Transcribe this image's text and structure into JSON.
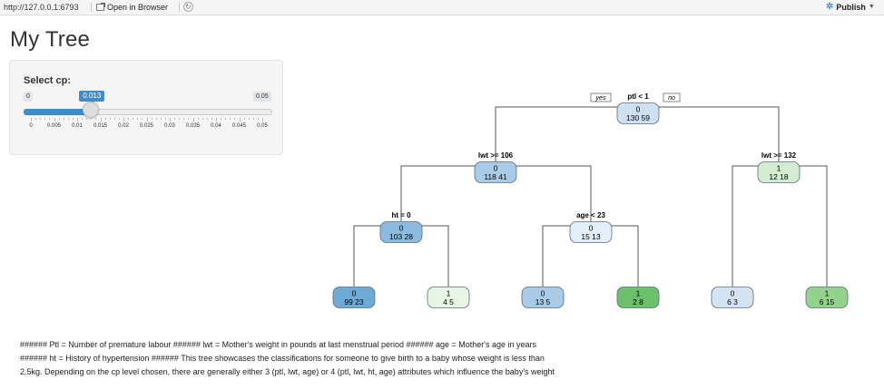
{
  "toolbar": {
    "url": "http://127.0.0.1:6793",
    "open_in_browser": "Open in Browser",
    "publish": "Publish"
  },
  "page": {
    "title": "My Tree"
  },
  "slider": {
    "label": "Select cp:",
    "min_label": "0",
    "max_label": "0.05",
    "value_label": "0.013",
    "value": 0.013,
    "min": 0,
    "max": 0.05,
    "ticks": [
      "0",
      "0.005",
      "0.01",
      "0.015",
      "0.02",
      "0.025",
      "0.03",
      "0.035",
      "0.04",
      "0.045",
      "0.05"
    ],
    "accent_color": "#428bca"
  },
  "tree": {
    "yes_label": "yes",
    "no_label": "no",
    "nodes": [
      {
        "id": "root",
        "cls": "0",
        "counts": "130  59",
        "split": "ptl < 1",
        "fill": "#cfe0f2"
      },
      {
        "id": "l",
        "cls": "0",
        "counts": "118  41",
        "split": "lwt >= 106",
        "fill": "#a8cbe8"
      },
      {
        "id": "r",
        "cls": "1",
        "counts": "12  18",
        "split": "lwt >= 132",
        "fill": "#d3ecd0"
      },
      {
        "id": "ll",
        "cls": "0",
        "counts": "103  28",
        "split": "ht = 0",
        "fill": "#8dbbe0"
      },
      {
        "id": "lr",
        "cls": "0",
        "counts": "15  13",
        "split": "age < 23",
        "fill": "#e4eef9"
      },
      {
        "id": "lll",
        "cls": "0",
        "counts": "99  23",
        "fill": "#6fa9d6"
      },
      {
        "id": "llr",
        "cls": "1",
        "counts": "4  5",
        "fill": "#e8f5e4"
      },
      {
        "id": "lrl",
        "cls": "0",
        "counts": "13  5",
        "fill": "#a9cbe8"
      },
      {
        "id": "lrr",
        "cls": "1",
        "counts": "2  8",
        "fill": "#6cc06a"
      },
      {
        "id": "rl",
        "cls": "0",
        "counts": "6  3",
        "fill": "#d3e3f4"
      },
      {
        "id": "rr",
        "cls": "1",
        "counts": "6  15",
        "fill": "#92d28d"
      }
    ]
  },
  "description": "###### Ptl = Number of premature labour ###### lwt = Mother's weight in pounds at last menstrual period ###### age = Mother's age in years ###### ht = History of hypertension ###### This tree showcases the classifications for someone to give birth to a baby whose weight is less than 2.5kg. Depending on the cp level chosen, there are generally either 3 (ptl, lwt, age) or 4 (ptl, lwt, ht, age) attributes which influence the baby's weight"
}
